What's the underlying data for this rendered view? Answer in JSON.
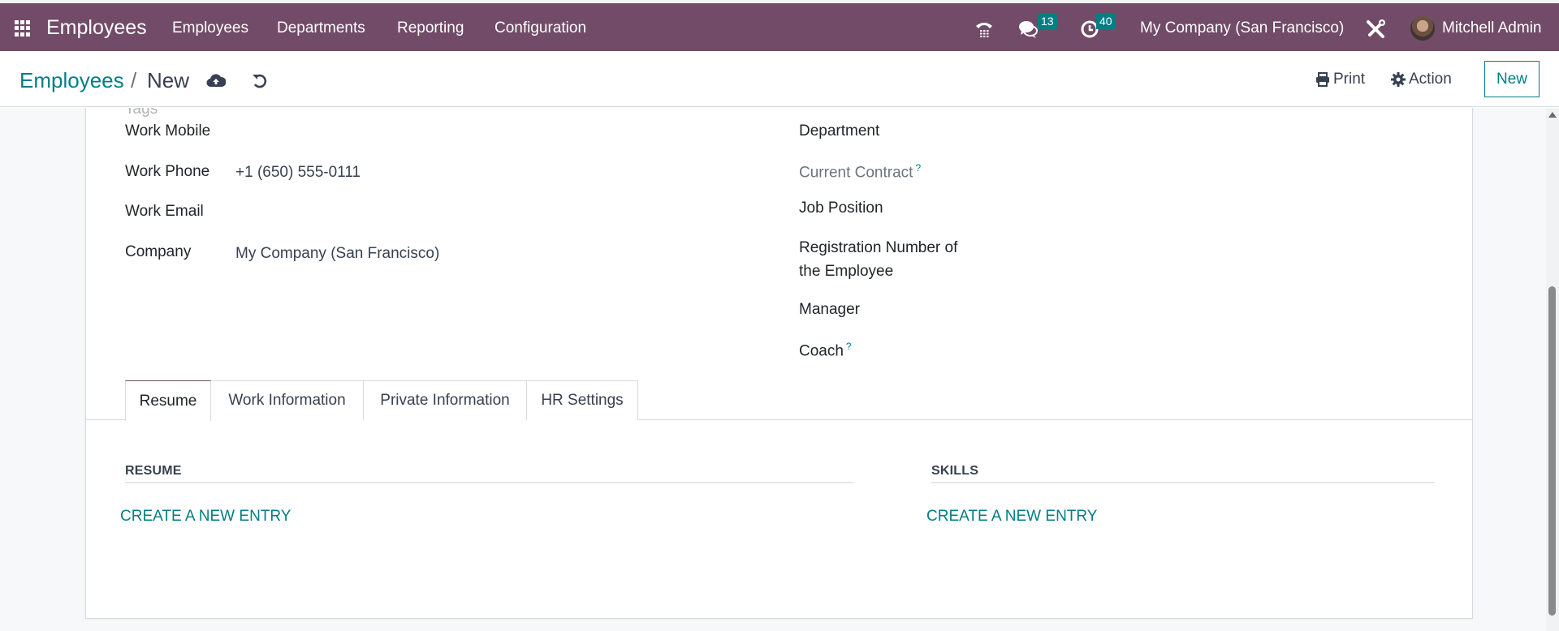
{
  "navbar": {
    "app_name": "Employees",
    "menu": [
      "Employees",
      "Departments",
      "Reporting",
      "Configuration"
    ],
    "icons": {
      "apps": "apps-grid-icon",
      "phone": "phone-icon",
      "messages": "chat-icon",
      "activities": "clock-icon",
      "settings": "tools-icon"
    },
    "messages_count": "13",
    "activities_count": "40",
    "company": "My Company (San Francisco)",
    "user": "Mitchell Admin"
  },
  "controlbar": {
    "breadcrumb_parent": "Employees",
    "breadcrumb_separator": "/",
    "breadcrumb_current": "New",
    "save_icon": "cloud-upload-icon",
    "discard_icon": "undo-icon",
    "print_label": "Print",
    "action_label": "Action",
    "new_label": "New"
  },
  "form": {
    "tags_label": "Tags",
    "left_fields": [
      {
        "label": "Work Mobile",
        "value": ""
      },
      {
        "label": "Work Phone",
        "value": "+1 (650) 555-0111"
      },
      {
        "label": "Work Email",
        "value": ""
      },
      {
        "label": "Company",
        "value": "My Company (San Francisco)"
      }
    ],
    "right_fields": [
      {
        "label": "Department",
        "value": ""
      },
      {
        "label": "Current Contract",
        "value": "",
        "help": "?"
      },
      {
        "label": "Job Position",
        "value": ""
      },
      {
        "label": "Registration Number of",
        "label_line2": "the Employee",
        "value": ""
      },
      {
        "label": "Manager",
        "value": ""
      },
      {
        "label": "Coach",
        "value": "",
        "help": "?"
      }
    ]
  },
  "tabs": [
    {
      "label": "Resume",
      "active": true
    },
    {
      "label": "Work Information",
      "active": false
    },
    {
      "label": "Private Information",
      "active": false
    },
    {
      "label": "HR Settings",
      "active": false
    }
  ],
  "resume_tab": {
    "resume_title": "RESUME",
    "resume_create": "CREATE A NEW ENTRY",
    "skills_title": "SKILLS",
    "skills_create": "CREATE A NEW ENTRY"
  },
  "colors": {
    "brand": "#714b67",
    "accent": "#017e84"
  }
}
